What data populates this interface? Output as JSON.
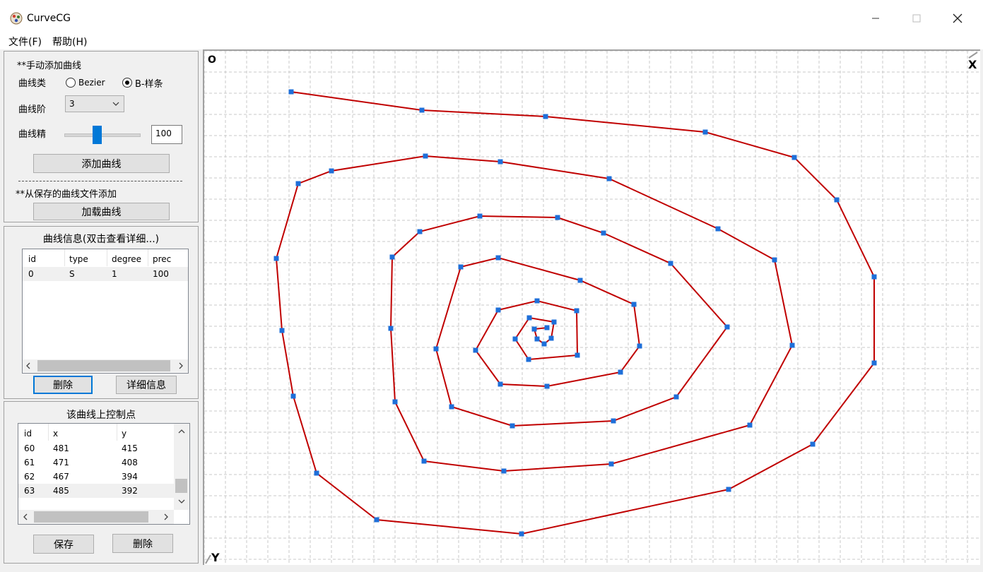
{
  "window": {
    "title": "CurveCG",
    "buttons": {
      "minimize": "—",
      "maximize": "☐",
      "close": "✕"
    }
  },
  "menu": [
    {
      "label": "文件(F)"
    },
    {
      "label": "帮助(H)"
    }
  ],
  "add_panel": {
    "manual_heading": "**手动添加曲线",
    "curve_type_label": "曲线类",
    "bezier_label": "Bezier",
    "bspline_label": "B-样条",
    "selected_type": "B-样条",
    "degree_label": "曲线阶",
    "degree_value": "3",
    "precision_label": "曲线精",
    "precision_value": "100",
    "precision_slider_fraction": 0.43,
    "add_button": "添加曲线",
    "file_heading": "**从保存的曲线文件添加",
    "load_button": "加载曲线"
  },
  "curve_info": {
    "title": "曲线信息(双击查看详细...)",
    "columns": [
      "id",
      "type",
      "degree",
      "prec"
    ],
    "rows": [
      {
        "id": "0",
        "type": "S",
        "degree": "1",
        "prec": "100"
      }
    ],
    "delete_button": "删除",
    "details_button": "详细信息"
  },
  "control_points": {
    "title": "该曲线上控制点",
    "columns": [
      "id",
      "x",
      "y"
    ],
    "rows": [
      {
        "id": "60",
        "x": "481",
        "y": "415"
      },
      {
        "id": "61",
        "x": "471",
        "y": "408"
      },
      {
        "id": "62",
        "x": "467",
        "y": "394"
      },
      {
        "id": "63",
        "x": "485",
        "y": "392"
      }
    ],
    "save_button": "保存",
    "delete_button": "删除"
  },
  "canvas": {
    "origin_label": "O",
    "x_axis_label": "X",
    "y_axis_label": "Y",
    "curve_color": "#c00000",
    "point_color": "#1e6fd9"
  },
  "chart_data": {
    "type": "scatter",
    "series": [
      {
        "values": [
          [
            123,
            58
          ],
          [
            308,
            84
          ],
          [
            483,
            93
          ],
          [
            709,
            115
          ],
          [
            835,
            151
          ],
          [
            895,
            211
          ],
          [
            948,
            320
          ],
          [
            948,
            442
          ],
          [
            861,
            557
          ],
          [
            742,
            621
          ],
          [
            449,
            684
          ],
          [
            244,
            664
          ],
          [
            159,
            598
          ],
          [
            126,
            489
          ],
          [
            110,
            396
          ],
          [
            102,
            294
          ],
          [
            133,
            188
          ],
          [
            180,
            170
          ],
          [
            313,
            149
          ],
          [
            419,
            157
          ],
          [
            573,
            181
          ],
          [
            727,
            252
          ],
          [
            807,
            296
          ],
          [
            832,
            417
          ],
          [
            772,
            530
          ],
          [
            576,
            585
          ],
          [
            424,
            595
          ],
          [
            311,
            581
          ],
          [
            270,
            497
          ],
          [
            264,
            393
          ],
          [
            266,
            292
          ],
          [
            305,
            256
          ],
          [
            390,
            234
          ],
          [
            500,
            236
          ],
          [
            565,
            258
          ],
          [
            660,
            301
          ],
          [
            740,
            391
          ],
          [
            668,
            490
          ],
          [
            579,
            524
          ],
          [
            436,
            531
          ],
          [
            350,
            504
          ],
          [
            328,
            422
          ],
          [
            363,
            306
          ],
          [
            416,
            293
          ],
          [
            532,
            325
          ],
          [
            608,
            359
          ],
          [
            616,
            418
          ],
          [
            589,
            455
          ],
          [
            485,
            475
          ],
          [
            419,
            472
          ],
          [
            384,
            424
          ],
          [
            416,
            367
          ],
          [
            471,
            354
          ],
          [
            527,
            368
          ],
          [
            528,
            431
          ],
          [
            459,
            437
          ],
          [
            440,
            408
          ],
          [
            460,
            378
          ],
          [
            495,
            384
          ],
          [
            491,
            407
          ],
          [
            481,
            415
          ],
          [
            471,
            408
          ],
          [
            467,
            394
          ],
          [
            485,
            392
          ]
        ]
      }
    ]
  }
}
